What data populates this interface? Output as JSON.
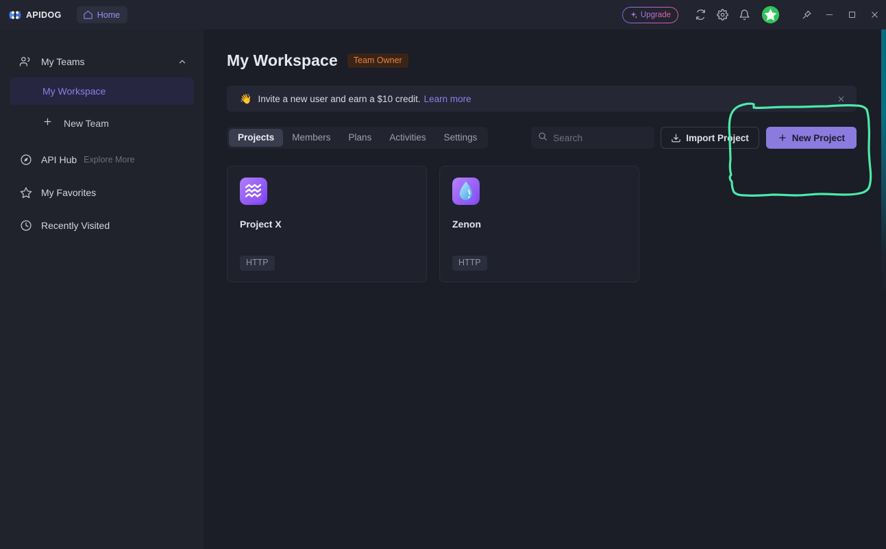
{
  "titlebar": {
    "brand_name": "APIDOG",
    "home_label": "Home",
    "upgrade_label": "Upgrade",
    "icons": [
      "sync-icon",
      "gear-icon",
      "bell-icon"
    ],
    "window_controls": [
      "pin-icon",
      "minimize-icon",
      "maximize-icon",
      "close-icon"
    ]
  },
  "sidebar": {
    "teams_header": {
      "label": "My Teams",
      "icon": "people-icon",
      "chevron": "chevron-up-icon"
    },
    "workspace": {
      "label": "My Workspace",
      "active": true
    },
    "new_team": {
      "label": "New Team",
      "icon": "plus-icon"
    },
    "items": [
      {
        "label": "API Hub",
        "sub": "Explore More",
        "icon": "compass-icon"
      },
      {
        "label": "My Favorites",
        "sub": "",
        "icon": "star-icon"
      },
      {
        "label": "Recently Visited",
        "sub": "",
        "icon": "clock-icon"
      }
    ]
  },
  "main": {
    "page_title": "My Workspace",
    "role_badge": "Team Owner",
    "banner": {
      "emoji": "👋",
      "text": "Invite a new user and earn a $10 credit.",
      "link": "Learn more",
      "close_icon": "close-icon"
    },
    "tabs": [
      {
        "label": "Projects",
        "active": true
      },
      {
        "label": "Members",
        "active": false
      },
      {
        "label": "Plans",
        "active": false
      },
      {
        "label": "Activities",
        "active": false
      },
      {
        "label": "Settings",
        "active": false
      }
    ],
    "search": {
      "value": "",
      "placeholder": "Search",
      "icon": "search-icon"
    },
    "import_button": {
      "label": "Import Project",
      "icon": "import-icon"
    },
    "new_button": {
      "label": "New Project",
      "icon": "plus-icon"
    },
    "projects": [
      {
        "name": "Project X",
        "tag": "HTTP",
        "icon": "aquarius-waves-icon"
      },
      {
        "name": "Zenon",
        "tag": "HTTP",
        "icon": "water-drop-icon"
      }
    ]
  },
  "annotation": {
    "type": "hand-drawn-rectangle",
    "color": "#4de8ab",
    "target": "new-project-button"
  },
  "colors": {
    "accent_purple": "#8b7bdf",
    "sidebar_bg": "#20222c",
    "main_bg": "#1b1d27",
    "titlebar_bg": "#22242f",
    "badge_orange": "#e8823c",
    "annotation_green": "#4de8ab",
    "edge_glow_teal": "#0a6a80"
  }
}
